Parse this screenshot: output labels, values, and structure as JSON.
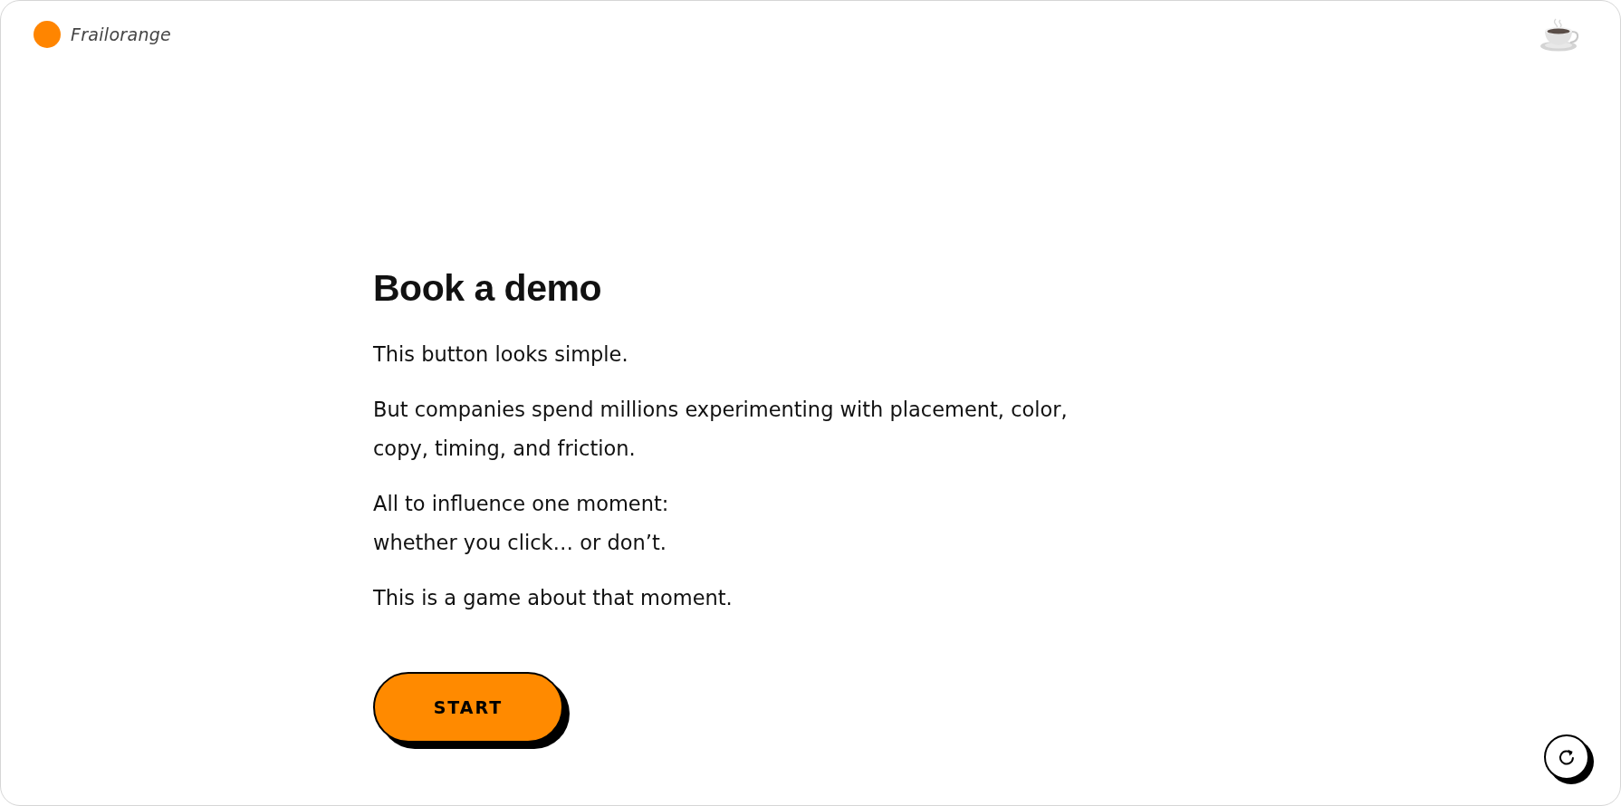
{
  "brand": {
    "name": "Frailorange"
  },
  "intro": {
    "title": "Book a demo",
    "paragraphs": [
      "This button looks simple.",
      "But companies spend millions experimenting with placement, color, copy, timing, and friction.",
      "All to influence one moment:\nwhether you click… or don’t.",
      "This is a game about that moment."
    ]
  },
  "start_button": {
    "label": "START"
  }
}
